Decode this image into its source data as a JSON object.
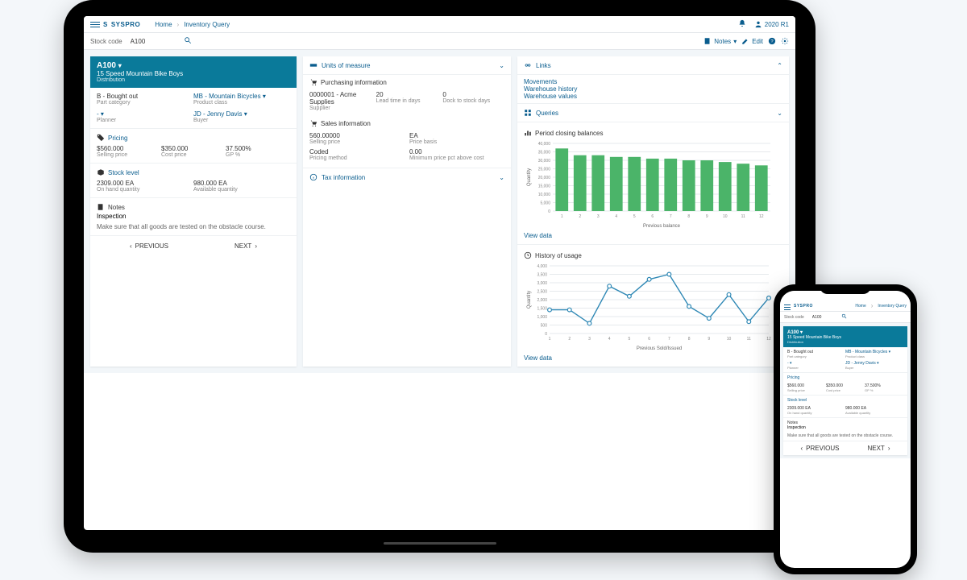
{
  "brand": "SYSPRO",
  "breadcrumbs": {
    "home": "Home",
    "page": "Inventory Query",
    "sep": "›"
  },
  "version": "2020 R1",
  "search": {
    "label": "Stock code",
    "value": "A100"
  },
  "actions": {
    "notes": "Notes",
    "edit": "Edit"
  },
  "item": {
    "code": "A100",
    "desc": "15 Speed Mountain Bike Boys",
    "sub": "Distribution"
  },
  "attrs": {
    "part_category": {
      "value": "B - Bought out",
      "label": "Part category"
    },
    "product_class": {
      "value": "MB - Mountain Bicycles",
      "label": "Product class"
    },
    "planner": {
      "value": "-",
      "label": "Planner"
    },
    "buyer": {
      "value": "JD - Jenny Davis",
      "label": "Buyer"
    }
  },
  "pricing": {
    "title": "Pricing",
    "selling_price": {
      "value": "$560.000",
      "label": "Selling price"
    },
    "cost_price": {
      "value": "$350.000",
      "label": "Cost price"
    },
    "gp": {
      "value": "37.500%",
      "label": "GP %"
    }
  },
  "stock": {
    "title": "Stock level",
    "on_hand": {
      "value": "2309.000 EA",
      "label": "On hand quantity"
    },
    "available": {
      "value": "980.000 EA",
      "label": "Available quantity"
    }
  },
  "notes": {
    "title": "Notes",
    "subtitle": "Inspection",
    "body": "Make sure that all goods are tested on the obstacle course."
  },
  "pager": {
    "prev": "PREVIOUS",
    "next": "NEXT"
  },
  "uom": {
    "title": "Units of measure",
    "purchasing": {
      "title": "Purchasing information",
      "supplier": {
        "value": "0000001 - Acme Supplies",
        "label": "Supplier"
      },
      "lead_time": {
        "value": "20",
        "label": "Lead time in days"
      },
      "dock_to_stock": {
        "value": "0",
        "label": "Dock to stock days"
      }
    },
    "sales": {
      "title": "Sales information",
      "selling_price": {
        "value": "560.00000",
        "label": "Selling price"
      },
      "price_basis": {
        "value": "EA",
        "label": "Price basis"
      },
      "pricing_method": {
        "value": "Coded",
        "label": "Pricing method"
      },
      "min_price_pct": {
        "value": "0.00",
        "label": "Minimum price pct above cost"
      }
    },
    "tax": {
      "title": "Tax information"
    }
  },
  "links": {
    "title": "Links",
    "items": [
      "Movements",
      "Warehouse history",
      "Warehouse values"
    ]
  },
  "queries": {
    "title": "Queries"
  },
  "chartA": {
    "title": "Period closing balances",
    "view": "View data"
  },
  "chartB": {
    "title": "History of usage",
    "view": "View data"
  },
  "axis": {
    "quantity": "Quantity",
    "prev_balance": "Previous balance",
    "prev_sold": "Previous Sold/Issued"
  },
  "chart_data": [
    {
      "type": "bar",
      "title": "Period closing balances",
      "xlabel": "Previous balance",
      "ylabel": "Quantity",
      "categories": [
        "1",
        "2",
        "3",
        "4",
        "5",
        "6",
        "7",
        "8",
        "9",
        "10",
        "11",
        "12"
      ],
      "values": [
        37000,
        33000,
        33000,
        32000,
        32000,
        31000,
        31000,
        30000,
        30000,
        29000,
        28000,
        27000
      ],
      "ylim": [
        0,
        40000
      ],
      "yticks": [
        0,
        5000,
        10000,
        15000,
        20000,
        25000,
        30000,
        35000,
        40000
      ]
    },
    {
      "type": "line",
      "title": "History of usage",
      "xlabel": "Previous Sold/Issued",
      "ylabel": "Quantity",
      "categories": [
        "1",
        "2",
        "3",
        "4",
        "5",
        "6",
        "7",
        "8",
        "9",
        "10",
        "11",
        "12"
      ],
      "values": [
        1400,
        1400,
        600,
        2800,
        2200,
        3200,
        3500,
        1600,
        900,
        2300,
        700,
        2100
      ],
      "ylim": [
        0,
        4000
      ],
      "yticks": [
        0,
        500,
        1000,
        1500,
        2000,
        2500,
        3000,
        3500,
        4000
      ]
    }
  ]
}
